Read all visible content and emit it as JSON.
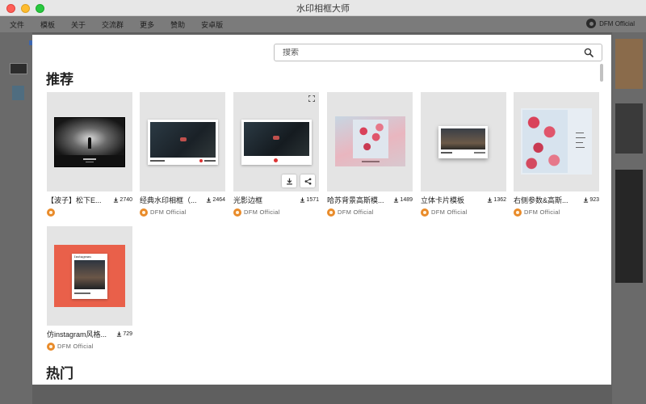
{
  "window": {
    "title": "水印相框大师"
  },
  "menu": [
    "文件",
    "模板",
    "关于",
    "交流群",
    "更多",
    "赞助",
    "安卓版"
  ],
  "account": {
    "name": "DFM Official"
  },
  "search": {
    "placeholder": "搜索"
  },
  "sections": {
    "recommended": "推荐",
    "hot": "热门"
  },
  "cards": [
    {
      "title": "【波子】松下E...",
      "downloads": "2740",
      "author": ""
    },
    {
      "title": "经典水印相框（...",
      "downloads": "2464",
      "author": "DFM Official"
    },
    {
      "title": "光影边框",
      "downloads": "1571",
      "author": "DFM Official"
    },
    {
      "title": "哈苏背景高斯模...",
      "downloads": "1489",
      "author": "DFM Official"
    },
    {
      "title": "立体卡片模板",
      "downloads": "1362",
      "author": "DFM Official"
    },
    {
      "title": "右侧参数&高斯...",
      "downloads": "923",
      "author": "DFM Official"
    },
    {
      "title": "仿instagram风格...",
      "downloads": "729",
      "author": "DFM Official"
    }
  ],
  "thumb_texts": {
    "instagram_header": "Instagram"
  },
  "icons": [
    "search-icon",
    "download-icon",
    "share-icon",
    "expand-icon",
    "user-avatar-icon"
  ],
  "colors": {
    "accent_orange": "#e98b2a",
    "coral": "#e9604a",
    "sakura": "#d9425a"
  }
}
